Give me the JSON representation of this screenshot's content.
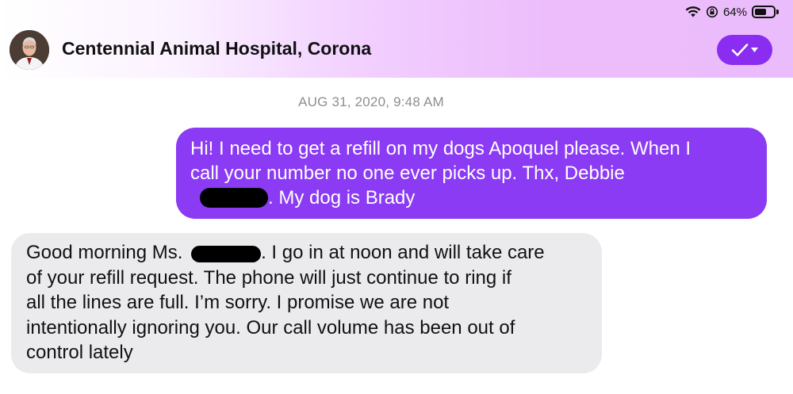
{
  "status_bar": {
    "battery_text": "64%",
    "battery_level": 0.64,
    "wifi_icon": "wifi-icon",
    "rotation_lock_icon": "rotation-lock-icon"
  },
  "header": {
    "contact_name": "Centennial Animal Hospital, Corona",
    "action_icon": "checkmark-dropdown-icon"
  },
  "conversation": {
    "timestamp": "AUG 31, 2020, 9:48 AM",
    "outgoing": {
      "line1": "Hi!  I need to get a refill on my dogs Apoquel please.  When I",
      "line2": "call your number no one ever picks up.  Thx, Debbie",
      "line3": ". My dog is Brady"
    },
    "incoming": {
      "line1_a": "Good morning Ms. ",
      "line1_b": ". I go in at noon and will take care",
      "line2": "of your refill request. The phone will just continue to ring if",
      "line3": "all the lines are full. I’m sorry. I promise we are not",
      "line4": "intentionally ignoring you. Our call volume has been out of",
      "line5": "control lately"
    }
  },
  "colors": {
    "outgoing_bubble": "#8a3bf3",
    "incoming_bubble": "#ebebed",
    "accent": "#8a2df0"
  }
}
